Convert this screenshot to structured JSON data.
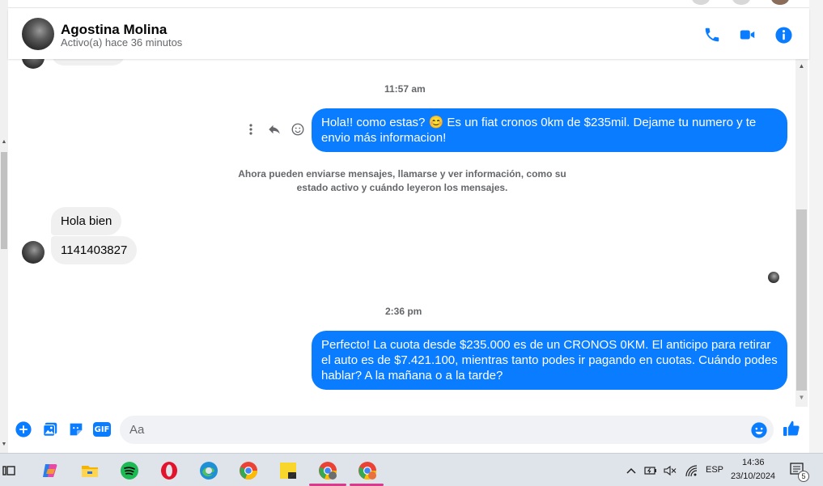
{
  "header": {
    "contact_name": "Agostina Molina",
    "contact_status": "Activo(a) hace 36 minutos",
    "icons": [
      "phone-icon",
      "video-camera-icon",
      "info-icon"
    ]
  },
  "messages": {
    "timestamp_1": "11:57 am",
    "outgoing_1": "Hola!! como estas? 😊 Es un fiat cronos 0km de $235mil. Dejame tu numero y te envio más informacion!",
    "notice": "Ahora pueden enviarse mensajes, llamarse y ver información, como su estado activo y cuándo leyeron los mensajes.",
    "incoming_1": "Hola bien",
    "incoming_2": "1141403827",
    "timestamp_2": "2:36 pm",
    "outgoing_2": "Perfecto! La cuota desde $235.000 es de un CRONOS 0KM. El anticipo para retirar el auto es de $7.421.100, mientras tanto podes ir pagando en cuotas. Cuándo podes hablar? A la mañana o a la tarde?"
  },
  "composer": {
    "placeholder": "Aa",
    "gif_label": "GIF"
  },
  "taskbar": {
    "language": "ESP",
    "time": "14:36",
    "date": "23/10/2024",
    "notification_count": "5"
  },
  "colors": {
    "accent": "#0a7cff",
    "incoming_bubble": "#f0f0f0",
    "taskbar": "#dfe3ea"
  }
}
